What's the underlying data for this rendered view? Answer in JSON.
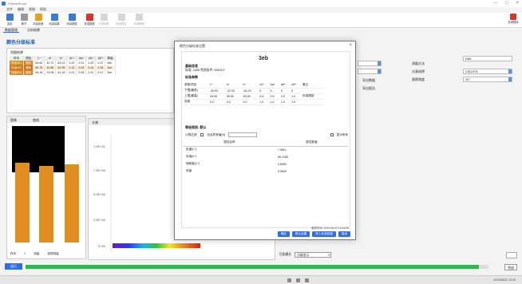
{
  "app": {
    "title": "ForeverFood"
  },
  "window_controls": {
    "minimize": "–",
    "maximize": "□",
    "close": "×"
  },
  "menu": [
    "文件",
    "编辑",
    "视图",
    "帮助"
  ],
  "ribbon": {
    "buttons": [
      {
        "label": "连接",
        "color": "#3a7bd5",
        "enabled": true
      },
      {
        "label": "断开",
        "color": "#999999",
        "enabled": true
      },
      {
        "label": "测量参数",
        "color": "#e0a31b",
        "enabled": true
      },
      {
        "label": "测量结果",
        "color": "#3a7bd5",
        "enabled": true
      },
      {
        "label": "测量数据",
        "color": "#3a7bd5",
        "enabled": true
      },
      {
        "label": "校准数据",
        "color": "#d9342b",
        "enabled": true
      },
      {
        "label": "分类设置",
        "color": "#8a8a8a",
        "enabled": false
      },
      {
        "label": "检测报告",
        "color": "#8a8a8a",
        "enabled": false
      },
      {
        "label": "标准管理",
        "color": "#8a8a8a",
        "enabled": false
      }
    ],
    "exit_label": "关闭程序"
  },
  "subtabs": [
    "数据管理",
    "分析结果"
  ],
  "section_title": "颜色分级标准",
  "results": {
    "caption": "测量结果",
    "headers": [
      "样本",
      "颜色",
      "L*",
      "a*",
      "b*",
      "ΔL*",
      "Δa*",
      "Δb*",
      "ΔE*",
      "等级"
    ],
    "rows": [
      [
        "样品001",
        "橙色",
        "64.62",
        "40.72",
        "63.13",
        "0.29",
        "0.11",
        "0.22",
        "0.37",
        "3eb"
      ],
      [
        "样品002",
        "橙色",
        "64.78",
        "40.85",
        "62.95",
        "0.13",
        "0.24",
        "0.04",
        "0.28",
        "3eb"
      ],
      [
        "样品003",
        "橙色",
        "64.18",
        "23.08",
        "61.18",
        "0.21",
        "0.28",
        "0.31",
        "0.47",
        "3eb"
      ]
    ]
  },
  "left_view": {
    "header_a": "图像",
    "header_b": "曲线",
    "footer": [
      "样本",
      "1",
      "测量",
      "选择测量"
    ]
  },
  "spectrum": {
    "header": "光谱",
    "ticks": [
      "1.0E+01",
      "7.5E+00",
      "5.0E+00",
      "2.5E+00",
      "0.0%"
    ]
  },
  "right_panel": {
    "label1": "测量方法",
    "label2": "光源选择",
    "label3": "观察角度",
    "value1": "D65",
    "value2": "CIE1976",
    "value3": "10°",
    "left_value1": "",
    "left_value2": "",
    "button_a": "导出数据",
    "button_b": "导出报告"
  },
  "dialog": {
    "title": "颜色分级标准设置",
    "grade": "3eb",
    "section1": "基础信息",
    "info1": "标准: 1806  检测条件: D65/10°",
    "section2": "标准参数",
    "table": [
      [
        "参数/项目",
        "L*",
        "a*",
        "b*",
        "ΔL*",
        "Δa*",
        "Δb*",
        "ΔE*",
        "备注"
      ],
      [
        "下限(最低)",
        "-40.00",
        "-22.00",
        "-52.20",
        "0",
        "0",
        "0",
        "0",
        ""
      ],
      [
        "上限(最高)",
        "99.99",
        "99.99",
        "99.99",
        "0.5",
        "0.5",
        "0.5",
        "1.0",
        "标准限制"
      ],
      [
        "容差",
        "0.0",
        "0.0",
        "0.0",
        "1.0",
        "1.0",
        "1.0",
        "1.5",
        ""
      ]
    ],
    "section3": "等级规则: 默认",
    "filter_label": "计算过滤:",
    "filter_check": "包含异常值(N)",
    "filter_right": "显示所有",
    "param_headers": [
      "属性名称",
      "属性数值"
    ],
    "params": [
      [
        "色度(L*)",
        "7.9611"
      ],
      [
        "色相(h°)",
        "95.1006"
      ],
      [
        "饱和度(C*)",
        "0.6000"
      ],
      [
        "亮度",
        "0.9800"
      ]
    ],
    "timestamp": "更新时间: 2023-08-22 13:24:55",
    "buttons": [
      "确定",
      "默认设置",
      "导入标准数据",
      "取消"
    ]
  },
  "bottom": {
    "label": "匹配模式",
    "select": "分级显示"
  },
  "mini_button": "完成",
  "statusbar": {
    "button": "运行",
    "progress": 0.98
  },
  "taskbar": {
    "right": "2023/08/22 13:25"
  }
}
